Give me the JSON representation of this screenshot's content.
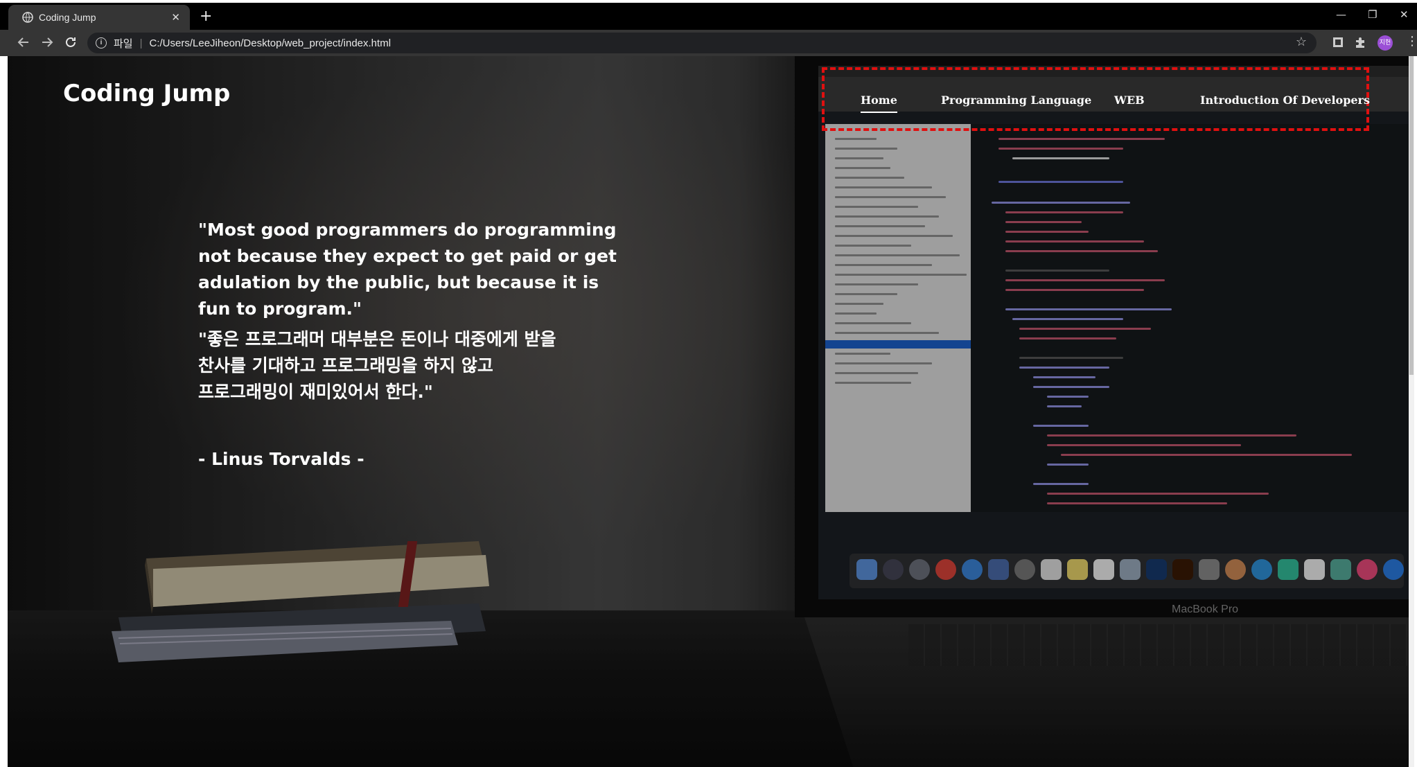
{
  "browser": {
    "tab_title": "Coding Jump",
    "new_tab": "+",
    "tab_close": "✕",
    "scheme_label": "파일",
    "url": "C:/Users/LeeJiheon/Desktop/web_project/index.html",
    "profile_initials": "지헌",
    "window_controls": {
      "minimize": "—",
      "restore": "❐",
      "close": "✕"
    }
  },
  "page": {
    "logo": "Coding Jump",
    "nav": {
      "items": [
        {
          "label": "Home",
          "active": true
        },
        {
          "label": "Programming Language",
          "active": false
        },
        {
          "label": "WEB",
          "active": false
        },
        {
          "label": "Introduction Of Developers",
          "active": false
        }
      ],
      "highlight_color": "#e01010"
    },
    "quote_en": "\"Most good programmers do programming not because they expect to get paid or get adulation by the public, but because it is fun to program.\"",
    "quote_ko_line1": "\"좋은 프로그래머 대부분은 돈이나 대중에게 받을",
    "quote_ko_line2": "찬사를 기대하고 프로그래밍을 하지 않고",
    "quote_ko_line3": "프로그래밍이 재미있어서 한다.\"",
    "author": "- Linus Torvalds -",
    "background_caption": "MacBook Pro"
  },
  "icons": {
    "back": "arrow-left-icon",
    "forward": "arrow-right-icon",
    "reload": "reload-icon",
    "info": "info-icon",
    "bookmark": "star-icon",
    "extensions": "puzzle-icon",
    "menu": "kebab-menu-icon"
  }
}
